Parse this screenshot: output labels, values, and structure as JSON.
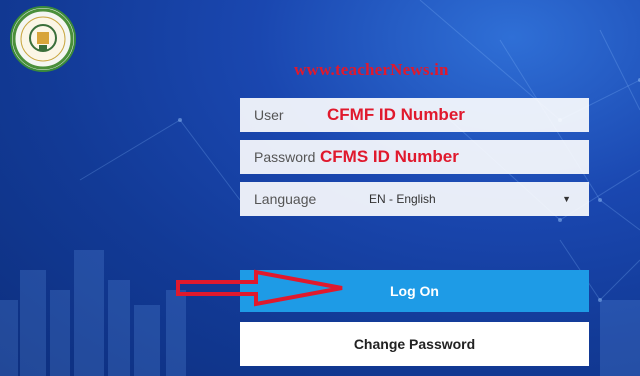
{
  "watermark": "www.teacherNews.in",
  "form": {
    "user_label": "User",
    "user_value": "CFMF ID Number",
    "password_label": "Password",
    "password_value": "CFMS ID Number",
    "language_label": "Language",
    "language_value": "EN - English"
  },
  "buttons": {
    "logon_label": "Log On",
    "change_password_label": "Change Password"
  },
  "icons": {
    "emblem": "government-emblem-icon",
    "caret": "chevron-down-icon",
    "arrow": "red-arrow-icon"
  },
  "colors": {
    "background": "#1a47b0",
    "logon_button": "#1e9be6",
    "annotation_red": "#e0192d"
  }
}
